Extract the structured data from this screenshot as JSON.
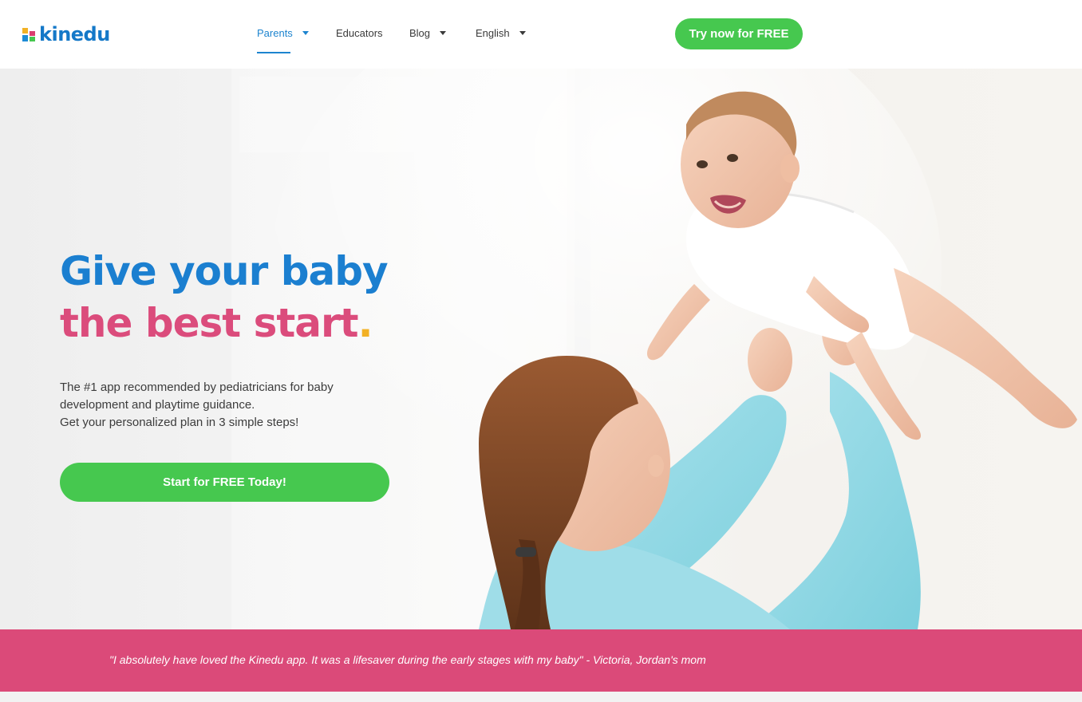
{
  "brand": {
    "name": "kinedu",
    "colors": {
      "blue": "#1b7fd0",
      "pink": "#db4c7c",
      "green": "#46c84f",
      "yellow": "#f2b125"
    }
  },
  "nav": {
    "items": [
      {
        "label": "Parents",
        "has_dropdown": true,
        "active": true
      },
      {
        "label": "Educators",
        "has_dropdown": false,
        "active": false
      },
      {
        "label": "Blog",
        "has_dropdown": true,
        "active": false
      },
      {
        "label": "English",
        "has_dropdown": true,
        "active": false
      }
    ],
    "cta_label": "Try now for FREE"
  },
  "hero": {
    "headline_line1": "Give your baby",
    "headline_line2": "the best start",
    "headline_dot": ".",
    "subtext_lines": [
      "The #1 app recommended by pediatricians for baby",
      "development and playtime guidance.",
      "Get your personalized plan in 3 simple steps!"
    ],
    "cta_label": "Start for FREE Today!"
  },
  "testimonial": {
    "quote": "\"I absolutely have loved the Kinedu app. It was a lifesaver during the early stages with my baby\" - Victoria, Jordan's mom"
  }
}
